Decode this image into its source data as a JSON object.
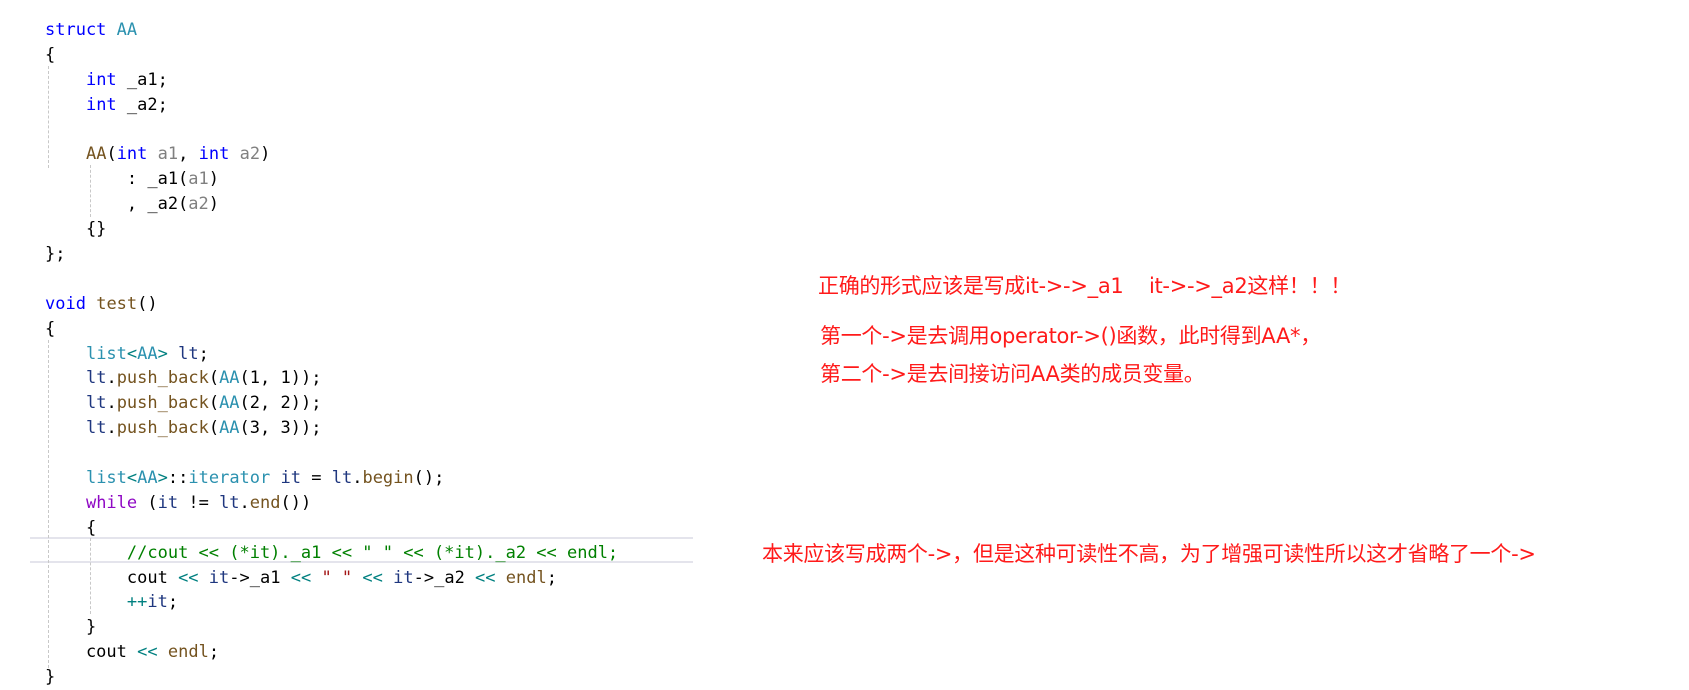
{
  "code": {
    "lines": [
      [
        [
          "kw",
          "struct"
        ],
        [
          "plain",
          " "
        ],
        [
          "type",
          "AA"
        ]
      ],
      [
        [
          "plain",
          "{"
        ]
      ],
      [
        [
          "plain",
          "    "
        ],
        [
          "kw",
          "int"
        ],
        [
          "plain",
          " _a1;"
        ]
      ],
      [
        [
          "plain",
          "    "
        ],
        [
          "kw",
          "int"
        ],
        [
          "plain",
          " _a2;"
        ]
      ],
      [
        [
          "plain",
          ""
        ]
      ],
      [
        [
          "plain",
          "    "
        ],
        [
          "fn",
          "AA"
        ],
        [
          "plain",
          "("
        ],
        [
          "kw",
          "int"
        ],
        [
          "plain",
          " "
        ],
        [
          "param",
          "a1"
        ],
        [
          "plain",
          ", "
        ],
        [
          "kw",
          "int"
        ],
        [
          "plain",
          " "
        ],
        [
          "param",
          "a2"
        ],
        [
          "plain",
          ")"
        ]
      ],
      [
        [
          "plain",
          "        : _a1("
        ],
        [
          "param",
          "a1"
        ],
        [
          "plain",
          ")"
        ]
      ],
      [
        [
          "plain",
          "        , _a2("
        ],
        [
          "param",
          "a2"
        ],
        [
          "plain",
          ")"
        ]
      ],
      [
        [
          "plain",
          "    {}"
        ]
      ],
      [
        [
          "plain",
          "};"
        ]
      ],
      [
        [
          "plain",
          ""
        ]
      ],
      [
        [
          "kw",
          "void"
        ],
        [
          "plain",
          " "
        ],
        [
          "fn",
          "test"
        ],
        [
          "plain",
          "()"
        ]
      ],
      [
        [
          "plain",
          "{"
        ]
      ],
      [
        [
          "plain",
          "    "
        ],
        [
          "type",
          "list"
        ],
        [
          "op",
          "<"
        ],
        [
          "type",
          "AA"
        ],
        [
          "op",
          ">"
        ],
        [
          "plain",
          " "
        ],
        [
          "var",
          "lt"
        ],
        [
          "plain",
          ";"
        ]
      ],
      [
        [
          "plain",
          "    "
        ],
        [
          "var",
          "lt"
        ],
        [
          "plain",
          "."
        ],
        [
          "fn",
          "push_back"
        ],
        [
          "plain",
          "("
        ],
        [
          "type",
          "AA"
        ],
        [
          "plain",
          "(1, 1));"
        ]
      ],
      [
        [
          "plain",
          "    "
        ],
        [
          "var",
          "lt"
        ],
        [
          "plain",
          "."
        ],
        [
          "fn",
          "push_back"
        ],
        [
          "plain",
          "("
        ],
        [
          "type",
          "AA"
        ],
        [
          "plain",
          "(2, 2));"
        ]
      ],
      [
        [
          "plain",
          "    "
        ],
        [
          "var",
          "lt"
        ],
        [
          "plain",
          "."
        ],
        [
          "fn",
          "push_back"
        ],
        [
          "plain",
          "("
        ],
        [
          "type",
          "AA"
        ],
        [
          "plain",
          "(3, 3));"
        ]
      ],
      [
        [
          "plain",
          ""
        ]
      ],
      [
        [
          "plain",
          "    "
        ],
        [
          "type",
          "list"
        ],
        [
          "op",
          "<"
        ],
        [
          "type",
          "AA"
        ],
        [
          "op",
          ">"
        ],
        [
          "plain",
          "::"
        ],
        [
          "type",
          "iterator"
        ],
        [
          "plain",
          " "
        ],
        [
          "var",
          "it"
        ],
        [
          "plain",
          " = "
        ],
        [
          "var",
          "lt"
        ],
        [
          "plain",
          "."
        ],
        [
          "fn",
          "begin"
        ],
        [
          "plain",
          "();"
        ]
      ],
      [
        [
          "plain",
          "    "
        ],
        [
          "ctrl",
          "while"
        ],
        [
          "plain",
          " ("
        ],
        [
          "var",
          "it"
        ],
        [
          "plain",
          " != "
        ],
        [
          "var",
          "lt"
        ],
        [
          "plain",
          "."
        ],
        [
          "fn",
          "end"
        ],
        [
          "plain",
          "())"
        ]
      ],
      [
        [
          "plain",
          "    {"
        ]
      ],
      [
        [
          "plain",
          "        "
        ],
        [
          "cm",
          "//cout << (*it)._a1 << \" \" << (*it)._a2 << endl;"
        ]
      ],
      [
        [
          "plain",
          "        cout "
        ],
        [
          "op",
          "<<"
        ],
        [
          "plain",
          " "
        ],
        [
          "var",
          "it"
        ],
        [
          "plain",
          "->_a1 "
        ],
        [
          "op",
          "<<"
        ],
        [
          "plain",
          " "
        ],
        [
          "str",
          "\" \""
        ],
        [
          "plain",
          " "
        ],
        [
          "op",
          "<<"
        ],
        [
          "plain",
          " "
        ],
        [
          "var",
          "it"
        ],
        [
          "plain",
          "->_a2 "
        ],
        [
          "op",
          "<<"
        ],
        [
          "plain",
          " "
        ],
        [
          "fn",
          "endl"
        ],
        [
          "plain",
          ";"
        ]
      ],
      [
        [
          "plain",
          "        "
        ],
        [
          "op",
          "++"
        ],
        [
          "var",
          "it"
        ],
        [
          "plain",
          ";"
        ]
      ],
      [
        [
          "plain",
          "    }"
        ]
      ],
      [
        [
          "plain",
          "    cout "
        ],
        [
          "op",
          "<<"
        ],
        [
          "plain",
          " "
        ],
        [
          "fn",
          "endl"
        ],
        [
          "plain",
          ";"
        ]
      ],
      [
        [
          "plain",
          "}"
        ]
      ]
    ]
  },
  "annotations": {
    "correct_form": "正确的形式应该是写成it->->_a1    it->->_a2这样！！！",
    "first_arrow": "第一个->是去调用operator->()函数，此时得到AA*，",
    "second_arrow": "第二个->是去间接访问AA类的成员变量。",
    "readability_note": "本来应该写成两个->，但是这种可读性不高，为了增强可读性所以这才省略了一个->"
  },
  "colors": {
    "annotation": "#ff1a1a",
    "keyword": "#0000ff",
    "type": "#2b91af",
    "comment": "#008000"
  }
}
